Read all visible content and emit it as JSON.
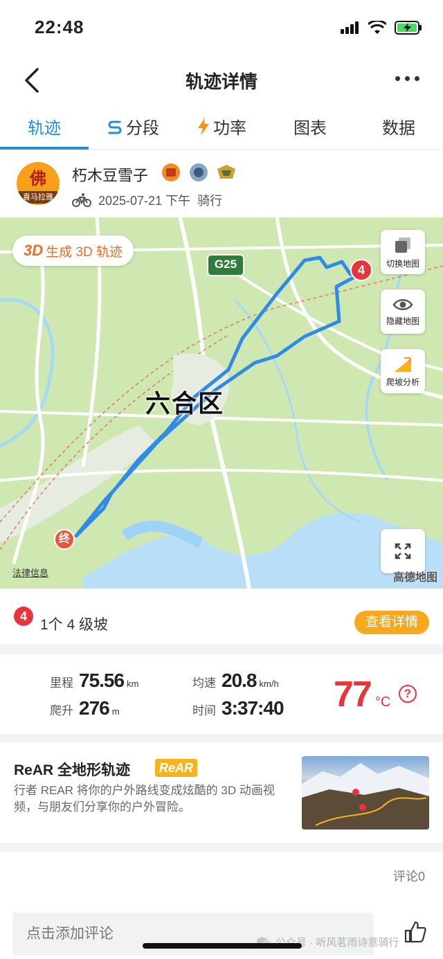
{
  "status_bar": {
    "time": "22:48"
  },
  "nav": {
    "title": "轨迹详情"
  },
  "tabs": [
    {
      "label": "轨迹",
      "icon": ""
    },
    {
      "label": "分段",
      "icon": "segment-icon"
    },
    {
      "label": "功率",
      "icon": "lightning-icon"
    },
    {
      "label": "图表",
      "icon": ""
    },
    {
      "label": "数据",
      "icon": ""
    }
  ],
  "user": {
    "name": "朽木豆雪子",
    "avatar_char": "佛",
    "avatar_label": "喜马拉雅",
    "date": "2025-07-21 下午",
    "activity": "骑行"
  },
  "map": {
    "btn_3d_prefix": "3D",
    "btn_3d_label": "生成 3D 轨迹",
    "highway": "G25",
    "district": "六合区",
    "switch_label": "切换地图",
    "hide_label": "隐藏地图",
    "climb_label": "爬坡分析",
    "legal": "法律信息",
    "provider": "高德地图",
    "climb_marker": "4",
    "end_marker": "终"
  },
  "climb": {
    "num": "4",
    "text": "1个 4 级坡",
    "button": "查看详情"
  },
  "stats": {
    "distance_label": "里程",
    "distance": "75.56",
    "distance_unit": "km",
    "avg_speed_label": "均速",
    "avg_speed": "20.8",
    "avg_speed_unit": "km/h",
    "ascent_label": "爬升",
    "ascent": "276",
    "ascent_unit": "m",
    "time_label": "时间",
    "time": "3:37:40",
    "temperature": "77",
    "temperature_unit": "°C",
    "help": "?"
  },
  "rear": {
    "title": "ReAR 全地形轨迹",
    "logo": "ReAR",
    "desc": "行者 REAR 将你的户外路线变成炫酷的 3D 动画视频，与朋友们分享你的户外冒险。"
  },
  "comments": {
    "count": "评论0",
    "input_placeholder": "点击添加评论"
  },
  "watermark": "公众号 · 听风茗雨诗意骑行",
  "colors": {
    "accent": "#1a8fe0",
    "orange": "#f7a81c",
    "red": "#e8343a",
    "route": "#2f8ae8"
  }
}
